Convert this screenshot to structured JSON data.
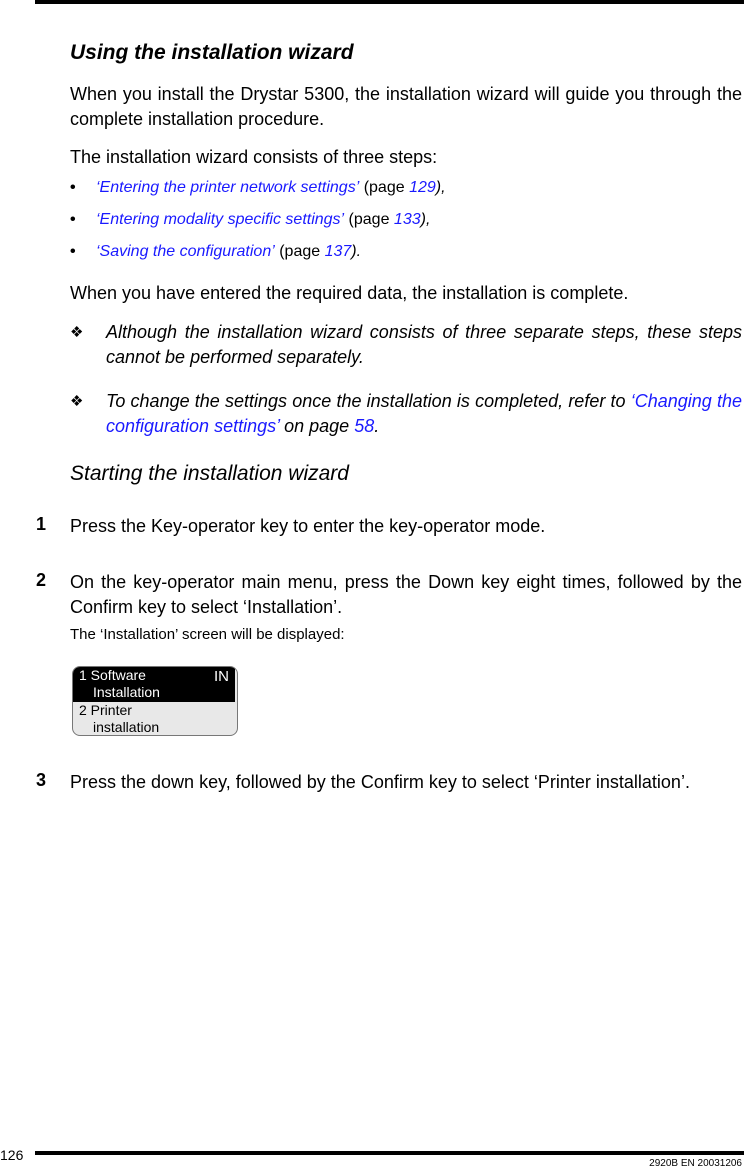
{
  "heading": "Using the installation wizard",
  "intro": "When you install the Drystar 5300, the installation wizard will guide you through the complete installation procedure.",
  "steps_intro": "The installation wizard consists of three steps:",
  "bullets": [
    {
      "link": "‘Entering the printer network settings’",
      "prefix": " (page ",
      "page": "129",
      "suffix": "),"
    },
    {
      "link": "‘Entering modality specific settings’",
      "prefix": " (page ",
      "page": "133",
      "suffix": "),"
    },
    {
      "link": "‘Saving the configuration’",
      "prefix": " (page ",
      "page": "137",
      "suffix": ")."
    }
  ],
  "complete_text": "When you have entered the required data, the installation is complete.",
  "notes": [
    {
      "symbol": "❖",
      "text": "Although the installation wizard consists of three separate steps, these steps cannot be performed separately."
    },
    {
      "symbol": "❖",
      "text_before": "To change the settings once the installation is completed, refer to ",
      "link": "‘Changing the configuration settings’",
      "text_mid": " on page ",
      "page": "58",
      "text_after": "."
    }
  ],
  "subheading": "Starting the installation wizard",
  "procedure": [
    {
      "num": "1",
      "text": "Press the Key-operator key to enter the key-operator mode."
    },
    {
      "num": "2",
      "text": "On the key-operator main menu, press the Down key eight times, followed by the Confirm key to select ‘Installation’.",
      "sub": "The ‘Installation’ screen will be displayed:"
    },
    {
      "num": "3",
      "text": "Press the down key, followed by the Confirm key to select ‘Printer installation’."
    }
  ],
  "lcd": {
    "item1_line1": "1 Software",
    "item1_line2": "Installation",
    "badge": "IN",
    "item2_line1": "2 Printer",
    "item2_line2": "installation"
  },
  "footer": {
    "page_number": "126",
    "doc_code": "2920B EN 20031206"
  },
  "colors": {
    "link": "#1a1aff"
  }
}
